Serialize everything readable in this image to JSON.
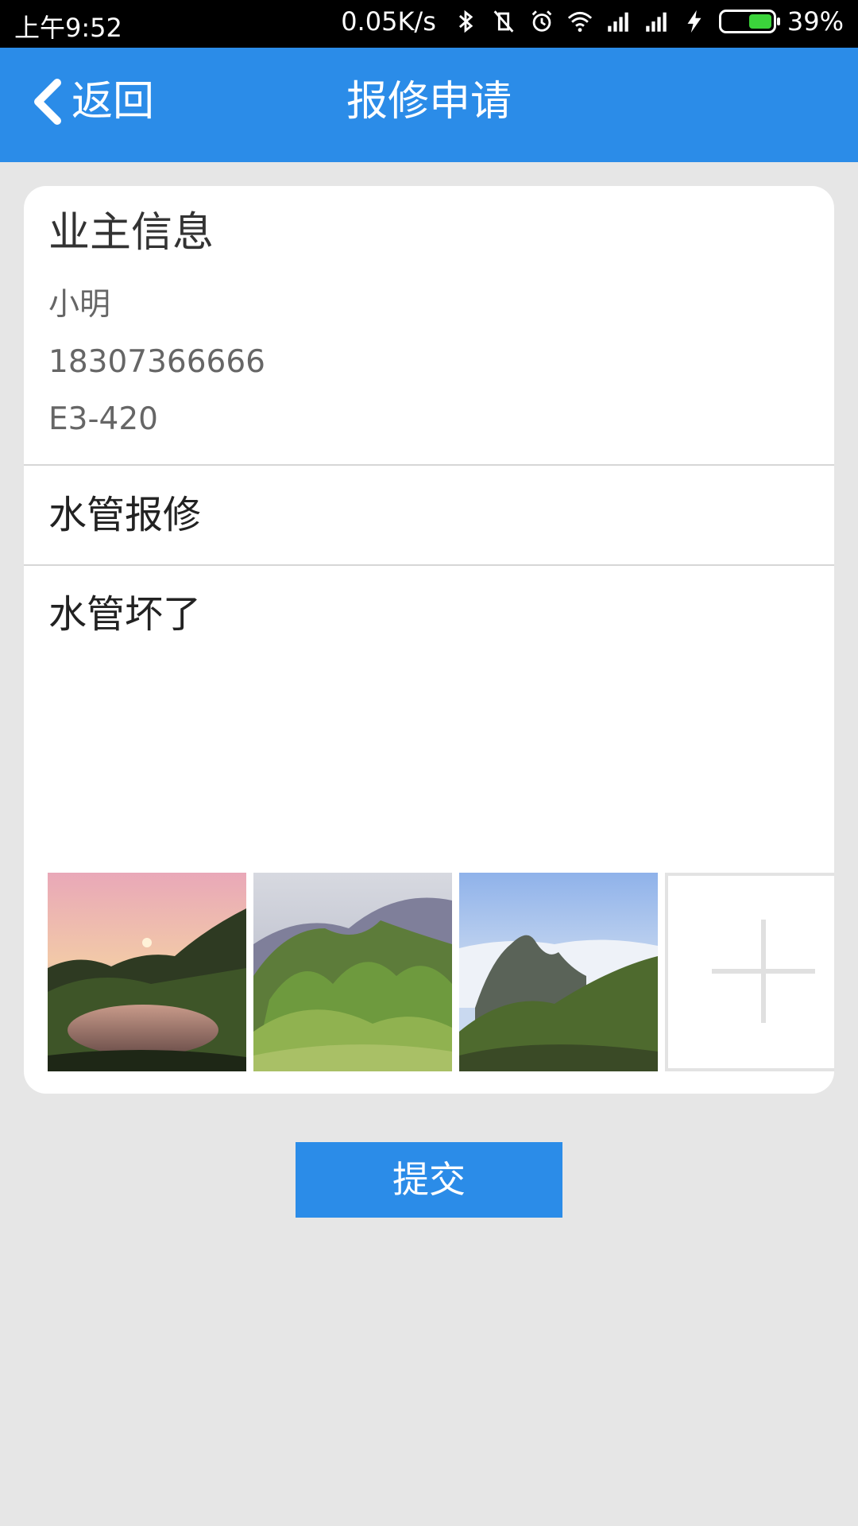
{
  "status_bar": {
    "time": "上午9:52",
    "net_speed": "0.05K/s",
    "battery_percent": "39%",
    "battery_level": 0.39,
    "icons": [
      "bluetooth-icon",
      "vibrate-off-icon",
      "alarm-icon",
      "wifi-icon",
      "signal-icon",
      "signal-icon",
      "charging-icon",
      "battery-icon"
    ]
  },
  "header": {
    "back_label": "返回",
    "title": "报修申请",
    "color": "#2b8ce8"
  },
  "owner": {
    "heading": "业主信息",
    "name": "小明",
    "phone": "18307366666",
    "room": "E3-420"
  },
  "repair": {
    "title": "水管报修",
    "description": "水管坏了"
  },
  "photos": [
    {
      "name": "sunset-lake-photo"
    },
    {
      "name": "green-hills-photo"
    },
    {
      "name": "cloud-sea-peak-photo"
    }
  ],
  "add_photo_icon": "plus-icon",
  "submit_label": "提交"
}
